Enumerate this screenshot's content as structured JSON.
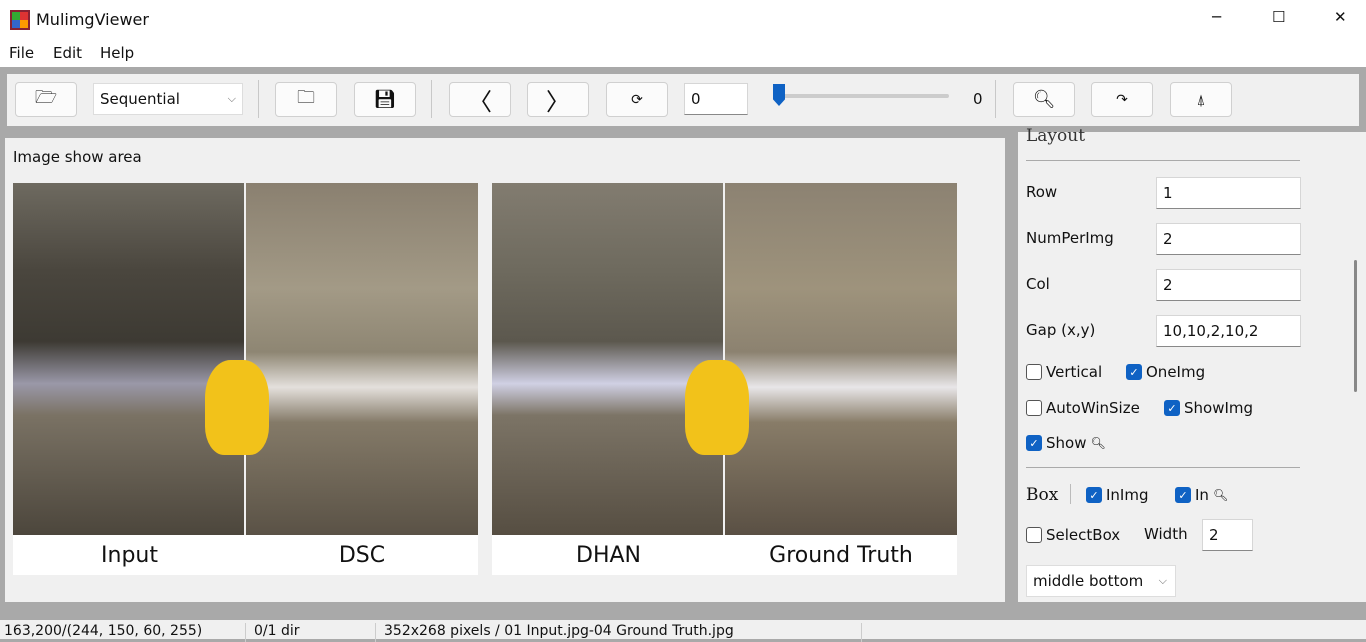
{
  "window": {
    "title": "MulimgViewer",
    "minimize": "─",
    "maximize": "☐",
    "close": "✕"
  },
  "menu": [
    "File",
    "Edit",
    "Help"
  ],
  "toolbar": {
    "mode_select": "Sequential",
    "index_value": "0",
    "slider_value": 0,
    "slider_label": "0"
  },
  "image_area": {
    "label": "Image show area",
    "captions": [
      "Input",
      "DSC",
      "DHAN",
      "Ground Truth"
    ]
  },
  "panel": {
    "section_title": "Layout",
    "fields": [
      {
        "label": "Row",
        "value": "1"
      },
      {
        "label": "NumPerImg",
        "value": "2"
      },
      {
        "label": "Col",
        "value": "2"
      },
      {
        "label": "Gap (x,y)",
        "value": "10,10,2,10,2"
      }
    ],
    "checkboxes": [
      {
        "label": "Vertical",
        "checked": false
      },
      {
        "label": "OneImg",
        "checked": true
      },
      {
        "label": "AutoWinSize",
        "checked": false
      },
      {
        "label": "ShowImg",
        "checked": true
      },
      {
        "label": "Show",
        "checked": true
      }
    ],
    "box_label": "Box",
    "box_checks": [
      {
        "label": "InImg",
        "checked": true
      },
      {
        "label": "In",
        "checked": true
      }
    ],
    "selectbox": {
      "label": "SelectBox",
      "checked": false
    },
    "width_label": "Width",
    "width_value": "2",
    "position_select": "middle bottom"
  },
  "status": [
    "163,200/(244, 150, 60, 255)",
    "0/1 dir",
    "352x268 pixels / 01 Input.jpg-04 Ground Truth.jpg"
  ],
  "colors": {
    "accent": "#0f62c4"
  }
}
